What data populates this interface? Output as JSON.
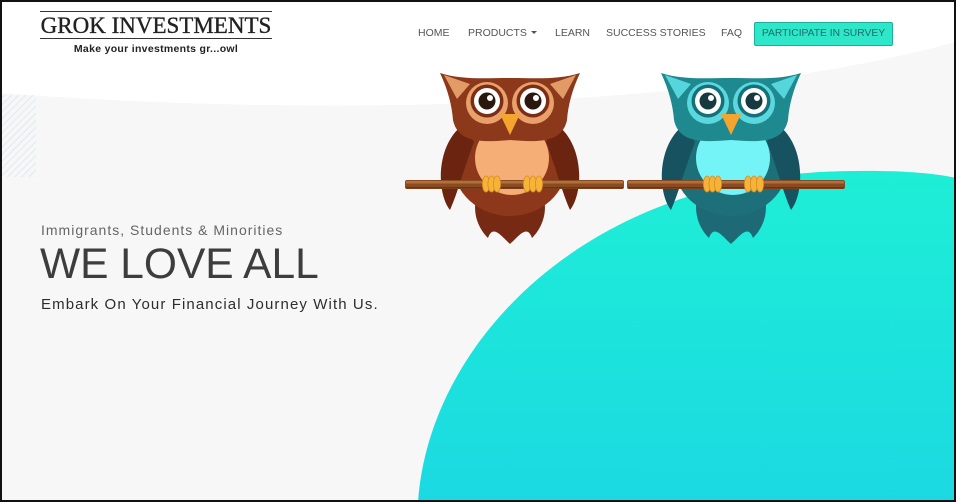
{
  "brand": {
    "name": "GROK INVESTMENTS",
    "tagline": "Make your investments gr...owl"
  },
  "nav": {
    "items": [
      {
        "label": "HOME"
      },
      {
        "label": "PRODUCTS",
        "icon": "caret-down-icon"
      },
      {
        "label": "LEARN"
      },
      {
        "label": "SUCCESS STORIES"
      },
      {
        "label": "FAQ"
      }
    ],
    "cta": {
      "label": "PARTICIPATE IN SURVEY"
    }
  },
  "hero": {
    "eyebrow": "Immigrants, Students & Minorities",
    "headline": "WE LOVE ALL",
    "subtext": "Embark On Your Financial Journey With Us."
  },
  "colors": {
    "accent": "#2ee6c8",
    "accent_border": "#1fae98",
    "accent_text": "#1a6f6d",
    "nav_text": "#555555",
    "headline": "#3d3d3d",
    "page_bg": "#f7f7f7",
    "blob_top": "#1eeed6",
    "blob_bottom": "#1bd9e2",
    "branch": "#8a4a22",
    "branch_highlight": "#b0703a",
    "beak": "#f4a52e",
    "toe": "#f6b33a"
  },
  "owls": [
    {
      "palette": {
        "head": "#8c381b",
        "ear": "#e29a66",
        "face": "#e9a06a",
        "ring": "#7b2e16",
        "pupil": "#2b170e",
        "body": "#8e381b",
        "wing": "#6a2410",
        "belly": "#f5ae76",
        "tail": "#772a13"
      }
    },
    {
      "palette": {
        "head": "#1f8990",
        "ear": "#56d6dc",
        "face": "#5bd7de",
        "ring": "#147079",
        "pupil": "#163a40",
        "body": "#1d6f7a",
        "wing": "#175261",
        "belly": "#75f4f8",
        "tail": "#1d6a76"
      }
    }
  ]
}
